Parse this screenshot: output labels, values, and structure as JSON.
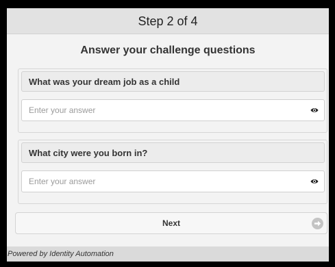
{
  "header": {
    "step_label": "Step 2 of 4"
  },
  "form": {
    "title": "Answer your challenge questions",
    "questions": [
      {
        "label": "What was your dream job as a child",
        "placeholder": "Enter your answer",
        "value": ""
      },
      {
        "label": "What city were you born in?",
        "placeholder": "Enter your answer",
        "value": ""
      }
    ],
    "next_label": "Next"
  },
  "footer": {
    "text": "Powered by Identity Automation"
  },
  "colors": {
    "background": "#f3f3f3",
    "header_bg": "#e2e2e2",
    "footer_bg": "#dadada",
    "border": "#d6d6d6"
  },
  "icons": {
    "reveal": "eye-icon",
    "next": "arrow-right-circle-icon"
  }
}
